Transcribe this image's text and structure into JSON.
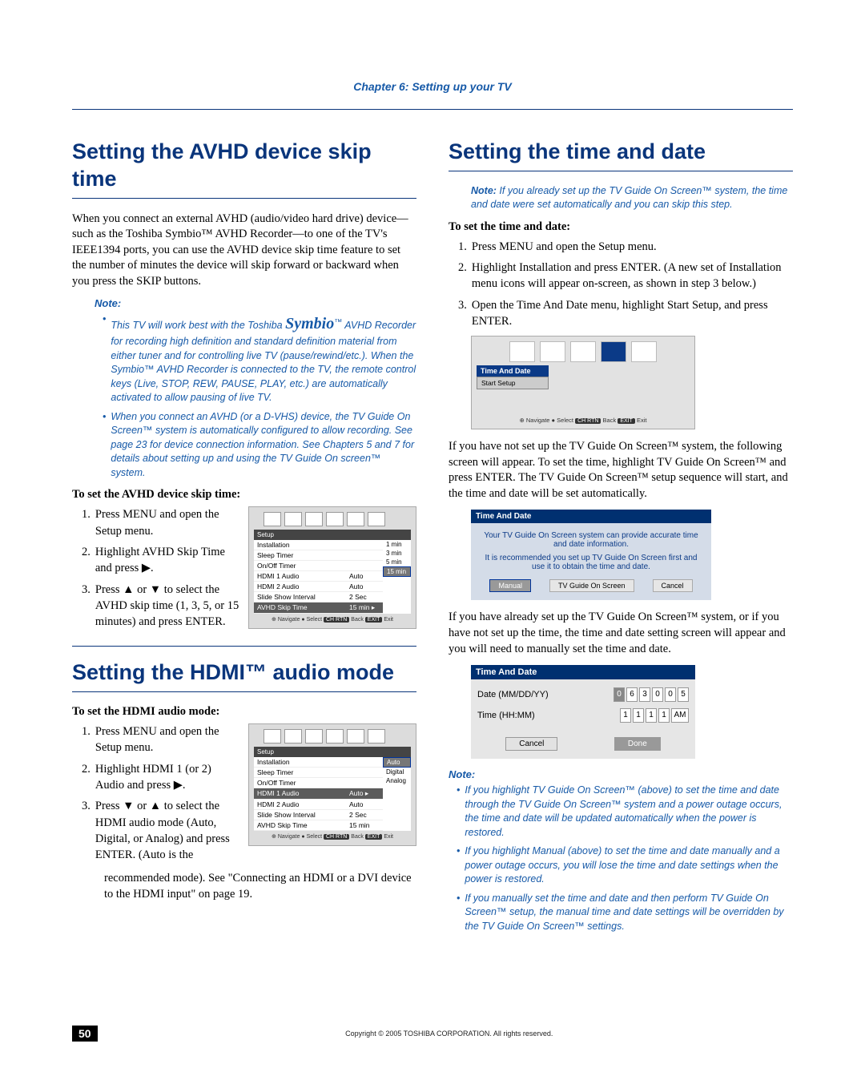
{
  "chapter": "Chapter 6: Setting up your TV",
  "left": {
    "h_avhd": "Setting the AVHD device skip time",
    "p_avhd": "When you connect an external AVHD (audio/video hard drive) device—such as the Toshiba Symbio™ AVHD Recorder—to one of the TV's IEEE1394 ports, you can use the AVHD device skip time feature to set the number of minutes the device will skip forward or backward when you press the SKIP buttons.",
    "note1_lbl": "Note:",
    "note1_a_pre": "This TV will work best with the Toshiba ",
    "note1_a_sym": "Symbio",
    "note1_a_post": " AVHD Recorder for recording high definition and standard definition material from either tuner and for controlling live TV (pause/rewind/etc.). When the Symbio™ AVHD Recorder is connected to the TV, the remote control keys (Live, STOP, REW, PAUSE, PLAY, etc.) are automatically activated to allow pausing of live TV.",
    "note1_b": "When you connect an AVHD (or a D-VHS) device, the TV Guide On Screen™ system is automatically configured to allow recording. See page 23 for device connection information. See Chapters 5 and 7 for details about setting up and using the TV Guide On screen™ system.",
    "avhd_steps_head": "To set the AVHD device skip time:",
    "avhd_s1": "Press MENU and open the Setup menu.",
    "avhd_s2": "Highlight AVHD Skip Time and press ▶.",
    "avhd_s3": "Press ▲ or ▼ to select the AVHD skip time (1, 3, 5, or 15 minutes) and press ENTER.",
    "menu1": {
      "tab": "Setup",
      "rows": [
        {
          "l": "Installation",
          "m": "",
          "r": ""
        },
        {
          "l": "Sleep Timer",
          "m": "",
          "r": ""
        },
        {
          "l": "On/Off Timer",
          "m": "",
          "r": ""
        },
        {
          "l": "HDMI 1 Audio",
          "m": "Auto",
          "r": ""
        },
        {
          "l": "HDMI 2 Audio",
          "m": "Auto",
          "r": ""
        },
        {
          "l": "Slide Show Interval",
          "m": "2 Sec",
          "r": ""
        },
        {
          "l": "AVHD Skip Time",
          "m": "15 min ▸",
          "r": "",
          "sel": true
        }
      ],
      "side": [
        "1 min",
        "3 min",
        "5 min",
        "15 min"
      ],
      "side_sel": 3,
      "nav": "Navigate ● Select",
      "back": "Back",
      "exit": "Exit"
    },
    "h_hdmi": "Setting the HDMI™ audio mode",
    "hdmi_steps_head": "To set the HDMI audio mode:",
    "hdmi_s1": "Press MENU and open the Setup menu.",
    "hdmi_s2": "Highlight HDMI 1 (or 2) Audio and press ▶.",
    "hdmi_s3": "Press ▼ or ▲ to select the HDMI audio mode (Auto, Digital, or Analog) and press ENTER. (Auto is the",
    "hdmi_tail": "recommended mode). See \"Connecting an HDMI or a DVI device to the HDMI input\" on page 19.",
    "menu2": {
      "tab": "Setup",
      "rows": [
        {
          "l": "Installation",
          "m": "",
          "r": ""
        },
        {
          "l": "Sleep Timer",
          "m": "",
          "r": ""
        },
        {
          "l": "On/Off Timer",
          "m": "",
          "r": ""
        },
        {
          "l": "HDMI 1 Audio",
          "m": "Auto ▸",
          "r": "",
          "sel": true
        },
        {
          "l": "HDMI 2 Audio",
          "m": "Auto",
          "r": ""
        },
        {
          "l": "Slide Show Interval",
          "m": "2 Sec",
          "r": ""
        },
        {
          "l": "AVHD Skip Time",
          "m": "15 min",
          "r": ""
        }
      ],
      "side": [
        "Auto",
        "Digital",
        "Analog"
      ],
      "side_sel": 0,
      "nav": "Navigate ● Select",
      "back": "Back",
      "exit": "Exit"
    }
  },
  "right": {
    "h_time": "Setting the time and date",
    "note_top": "Note:",
    "note_top_body": " If you already set up the TV Guide On Screen™ system, the time and date were set automatically and you can skip this step.",
    "steps_head": "To set the time and date:",
    "s1": "Press MENU and open the Setup menu.",
    "s2": "Highlight Installation and press ENTER. (A new set of Installation menu icons will appear on-screen, as shown in step 3 below.)",
    "s3": "Open the Time And Date menu, highlight Start Setup, and press ENTER.",
    "shot1": {
      "tab": "Time And Date",
      "start": "Start Setup",
      "nav": "Navigate ● Select",
      "back": "Back",
      "exit": "Exit"
    },
    "p_after1": "If you have not set up the TV Guide On Screen™ system, the following screen will appear. To set the time, highlight TV Guide On Screen™ and press ENTER. The TV Guide On Screen™ setup sequence will start, and the time and date will be set automatically.",
    "tg": {
      "head": "Time And Date",
      "msg1": "Your TV Guide On Screen system can provide accurate time and date information.",
      "msg2": "It is recommended you set up TV Guide On Screen first and use it to obtain the time and date.",
      "b1": "Manual",
      "b2": "TV Guide On Screen",
      "b3": "Cancel"
    },
    "p_after2": "If you have already set up the TV Guide On Screen™ system, or if you have not set up the time, the time and date setting screen will appear and you will need to manually set the time and date.",
    "tp": {
      "head": "Time And Date",
      "date_lbl": "Date (MM/DD/YY)",
      "date": [
        "0",
        "6",
        "3",
        "0",
        "0",
        "5"
      ],
      "time_lbl": "Time (HH:MM)",
      "time": [
        "1",
        "1",
        "1",
        "1",
        "AM"
      ],
      "cancel": "Cancel",
      "done": "Done"
    },
    "note2_lbl": "Note:",
    "note2_a": "If you highlight TV Guide On Screen™ (above) to set the time and date through the TV Guide On Screen™ system and a power outage occurs, the time and date will be updated automatically when the power is restored.",
    "note2_b": "If you highlight Manual (above) to set the time and date manually and a power outage occurs, you will lose the time and date settings when the power is restored.",
    "note2_c": "If you manually set the time and date and then perform TV Guide On Screen™ setup, the manual time and date settings will be overridden by the TV Guide On Screen™ settings."
  },
  "footer": {
    "page": "50",
    "copy": "Copyright © 2005 TOSHIBA CORPORATION. All rights reserved."
  }
}
